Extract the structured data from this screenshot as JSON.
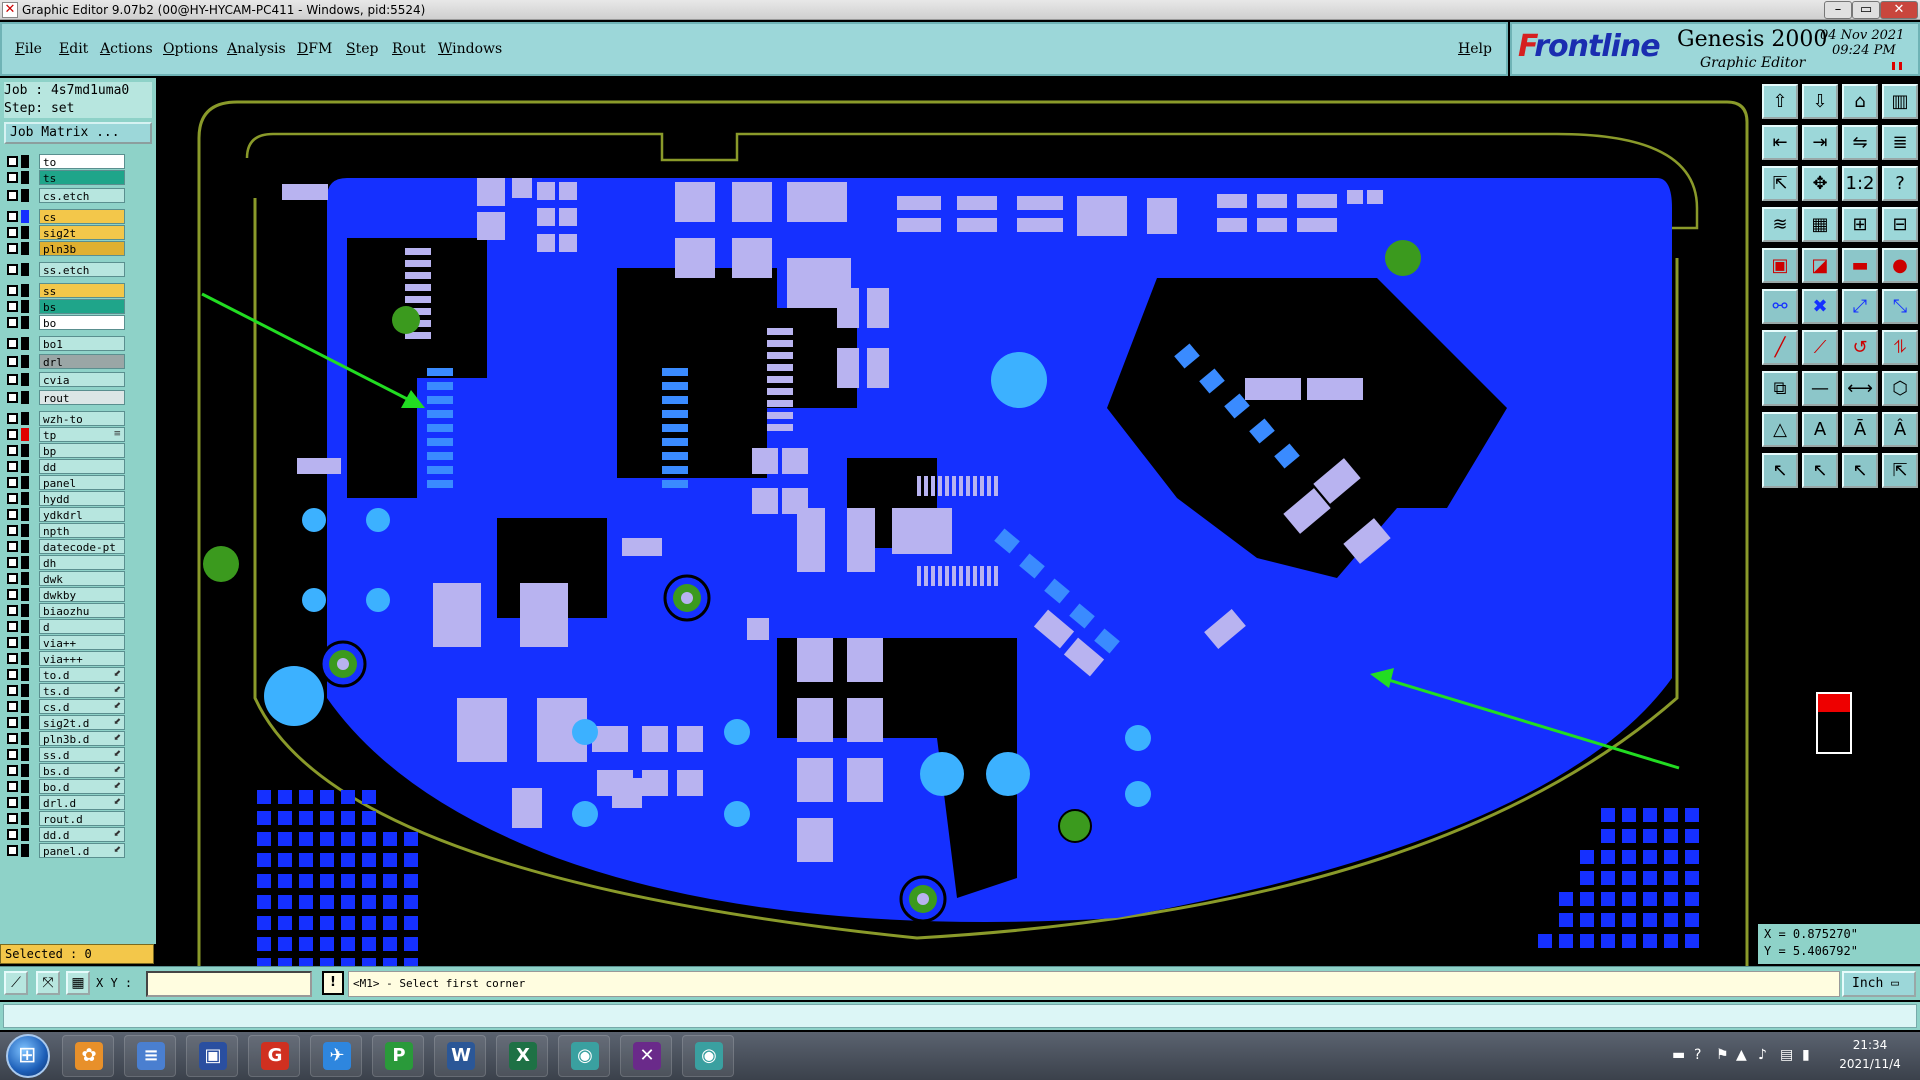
{
  "window": {
    "title": "Graphic Editor 9.07b2 (00@HY-HYCAM-PC411 - Windows, pid:5524)",
    "min_glyph": "–",
    "max_glyph": "▭",
    "close_glyph": "✕"
  },
  "menu": {
    "items": [
      "File",
      "Edit",
      "Actions",
      "Options",
      "Analysis",
      "DFM",
      "Step",
      "Rout",
      "Windows"
    ],
    "help": "Help"
  },
  "brand": {
    "logo_f": "F",
    "logo_rest": "rontline",
    "product": "Genesis 2000",
    "subtitle": "Graphic Editor",
    "date": "04 Nov 2021",
    "time": "09:24 PM"
  },
  "job": {
    "job_line": "Job : 4s7md1uma0",
    "step_line": "Step: set",
    "matrix_button": "Job Matrix ..."
  },
  "layers": [
    {
      "name": "to",
      "color": "#ffffff",
      "swatch": "#000000"
    },
    {
      "name": "ts",
      "color": "#1fa58a",
      "swatch": "#000000"
    },
    {
      "name": "cs.etch",
      "color": "#b7e6df",
      "swatch": "#000000"
    },
    {
      "name": "cs",
      "color": "#f3c74a",
      "swatch": "#1530ff"
    },
    {
      "name": "sig2t",
      "color": "#f3c74a",
      "swatch": "#000000"
    },
    {
      "name": "pln3b",
      "color": "#e0b030",
      "swatch": "#000000"
    },
    {
      "name": "ss.etch",
      "color": "#b7e6df",
      "swatch": "#000000"
    },
    {
      "name": "ss",
      "color": "#f3c74a",
      "swatch": "#000000"
    },
    {
      "name": "bs",
      "color": "#1fa58a",
      "swatch": "#000000"
    },
    {
      "name": "bo",
      "color": "#ffffff",
      "swatch": "#000000"
    },
    {
      "name": "bo1",
      "color": "#b7e6df",
      "swatch": "#000000"
    },
    {
      "name": "drl",
      "color": "#9aa6a6",
      "swatch": "#000000"
    },
    {
      "name": "cvia",
      "color": "#b7e6df",
      "swatch": "#000000"
    },
    {
      "name": "rout",
      "color": "#dce6e6",
      "swatch": "#000000"
    },
    {
      "name": "wzh-to",
      "color": "#b7e6df",
      "swatch": "#000000"
    },
    {
      "name": "tp",
      "color": "#b7e6df",
      "swatch": "#e00000",
      "flag": "≡"
    },
    {
      "name": "bp",
      "color": "#b7e6df",
      "swatch": "#000000"
    },
    {
      "name": "dd",
      "color": "#b7e6df",
      "swatch": "#000000"
    },
    {
      "name": "panel",
      "color": "#b7e6df",
      "swatch": "#000000"
    },
    {
      "name": "hydd",
      "color": "#b7e6df",
      "swatch": "#000000"
    },
    {
      "name": "ydkdrl",
      "color": "#b7e6df",
      "swatch": "#000000"
    },
    {
      "name": "npth",
      "color": "#b7e6df",
      "swatch": "#000000"
    },
    {
      "name": "datecode-pt",
      "color": "#b7e6df",
      "swatch": "#000000"
    },
    {
      "name": "dh",
      "color": "#b7e6df",
      "swatch": "#000000"
    },
    {
      "name": "dwk",
      "color": "#b7e6df",
      "swatch": "#000000"
    },
    {
      "name": "dwkby",
      "color": "#b7e6df",
      "swatch": "#000000"
    },
    {
      "name": "biaozhu",
      "color": "#b7e6df",
      "swatch": "#000000"
    },
    {
      "name": "d",
      "color": "#b7e6df",
      "swatch": "#000000"
    },
    {
      "name": "via++",
      "color": "#b7e6df",
      "swatch": "#000000"
    },
    {
      "name": "via+++",
      "color": "#b7e6df",
      "swatch": "#000000"
    },
    {
      "name": "to.d",
      "color": "#b7e6df",
      "swatch": "#000000",
      "flag": "⬋"
    },
    {
      "name": "ts.d",
      "color": "#b7e6df",
      "swatch": "#000000",
      "flag": "⬋"
    },
    {
      "name": "cs.d",
      "color": "#b7e6df",
      "swatch": "#000000",
      "flag": "⬋"
    },
    {
      "name": "sig2t.d",
      "color": "#b7e6df",
      "swatch": "#000000",
      "flag": "⬋"
    },
    {
      "name": "pln3b.d",
      "color": "#b7e6df",
      "swatch": "#000000",
      "flag": "⬋"
    },
    {
      "name": "ss.d",
      "color": "#b7e6df",
      "swatch": "#000000",
      "flag": "⬋"
    },
    {
      "name": "bs.d",
      "color": "#b7e6df",
      "swatch": "#000000",
      "flag": "⬋"
    },
    {
      "name": "bo.d",
      "color": "#b7e6df",
      "swatch": "#000000",
      "flag": "⬋"
    },
    {
      "name": "drl.d",
      "color": "#b7e6df",
      "swatch": "#000000",
      "flag": "⬋"
    },
    {
      "name": "rout.d",
      "color": "#b7e6df",
      "swatch": "#000000"
    },
    {
      "name": "dd.d",
      "color": "#b7e6df",
      "swatch": "#000000",
      "flag": "⬋"
    },
    {
      "name": "panel.d",
      "color": "#b7e6df",
      "swatch": "#000000",
      "flag": "⬋"
    }
  ],
  "selected": "Selected : 0",
  "toolbar": [
    {
      "name": "open-step-icon",
      "glyph": "⇧"
    },
    {
      "name": "save-icon",
      "glyph": "⇩"
    },
    {
      "name": "home-icon",
      "glyph": "⌂"
    },
    {
      "name": "layout-icon",
      "glyph": "▥"
    },
    {
      "name": "prev-icon",
      "glyph": "⇤"
    },
    {
      "name": "next-icon",
      "glyph": "⇥"
    },
    {
      "name": "mirror-icon",
      "glyph": "⇋"
    },
    {
      "name": "stack-icon",
      "glyph": "≣"
    },
    {
      "name": "fit-icon",
      "glyph": "⇱"
    },
    {
      "name": "center-icon",
      "glyph": "✥"
    },
    {
      "name": "scale-icon",
      "glyph": "1:2"
    },
    {
      "name": "query-icon",
      "glyph": "?"
    },
    {
      "name": "profile-icon",
      "glyph": "≋"
    },
    {
      "name": "grid-icon",
      "glyph": "▦"
    },
    {
      "name": "compare-icon",
      "glyph": "⊞"
    },
    {
      "name": "measure-icon",
      "glyph": "⊟"
    },
    {
      "name": "snapshot-icon",
      "glyph": "▣"
    },
    {
      "name": "erase-icon",
      "glyph": "◪"
    },
    {
      "name": "ruler-icon",
      "glyph": "▬"
    },
    {
      "name": "pad-icon",
      "glyph": "●"
    },
    {
      "name": "net-icon",
      "glyph": "⚯"
    },
    {
      "name": "cross-icon",
      "glyph": "✖"
    },
    {
      "name": "connect-icon",
      "glyph": "⤢"
    },
    {
      "name": "move-node-icon",
      "glyph": "⤡"
    },
    {
      "name": "line-icon",
      "glyph": "╱"
    },
    {
      "name": "slash-icon",
      "glyph": "⟋"
    },
    {
      "name": "arc-icon",
      "glyph": "↺"
    },
    {
      "name": "trace-icon",
      "glyph": "⥮"
    },
    {
      "name": "copy-icon",
      "glyph": "⧉"
    },
    {
      "name": "minus-icon",
      "glyph": "—"
    },
    {
      "name": "resize-icon",
      "glyph": "⟷"
    },
    {
      "name": "polygon-icon",
      "glyph": "⬡"
    },
    {
      "name": "triangle-icon",
      "glyph": "△"
    },
    {
      "name": "triangle-a-icon",
      "glyph": "A"
    },
    {
      "name": "triangle-b-icon",
      "glyph": "Ā"
    },
    {
      "name": "triangle-c-icon",
      "glyph": "Â"
    },
    {
      "name": "pointer-icon",
      "glyph": "↖"
    },
    {
      "name": "pointer-select-icon",
      "glyph": "↖"
    },
    {
      "name": "pointer-add-icon",
      "glyph": "↖"
    },
    {
      "name": "pointer-multi-icon",
      "glyph": "⇱"
    }
  ],
  "coords": {
    "x_line": "X = 0.875270\"",
    "y_line": "Y = 5.406792\""
  },
  "command": {
    "xy_label": "X Y :",
    "xy_value": "",
    "prompt": "<M1> - Select first corner",
    "prompt_icon": "!",
    "units": "Inch ▭"
  },
  "taskbar": {
    "start_glyph": "⊞",
    "apps": [
      {
        "name": "taskbar-shell-icon",
        "glyph": "✿",
        "color": "#e8902a"
      },
      {
        "name": "taskbar-notepad-icon",
        "glyph": "≡",
        "color": "#4a7fd0"
      },
      {
        "name": "taskbar-save-icon",
        "glyph": "▣",
        "color": "#2a4fa0"
      },
      {
        "name": "taskbar-g-app-icon",
        "glyph": "G",
        "color": "#d03020"
      },
      {
        "name": "taskbar-feather-icon",
        "glyph": "✈",
        "color": "#2e86de"
      },
      {
        "name": "taskbar-p-app-icon",
        "glyph": "P",
        "color": "#2a9a3a"
      },
      {
        "name": "taskbar-word-icon",
        "glyph": "W",
        "color": "#2b5797"
      },
      {
        "name": "taskbar-excel-icon",
        "glyph": "X",
        "color": "#1e7145"
      },
      {
        "name": "taskbar-eye-app-icon",
        "glyph": "◉",
        "color": "#3aa0a0"
      },
      {
        "name": "taskbar-x-app-icon",
        "glyph": "✕",
        "color": "#6a2a8a"
      },
      {
        "name": "taskbar-genesis-icon",
        "glyph": "◉",
        "color": "#3aa0a0"
      }
    ],
    "clock_time": "21:34",
    "clock_date": "2021/11/4"
  },
  "colors": {
    "board_copper": "#1530ff",
    "board_pads": "#b8b3f0",
    "vias": "#3cb1ff",
    "outline": "#8a9a2a",
    "arrow": "#22dd22"
  }
}
